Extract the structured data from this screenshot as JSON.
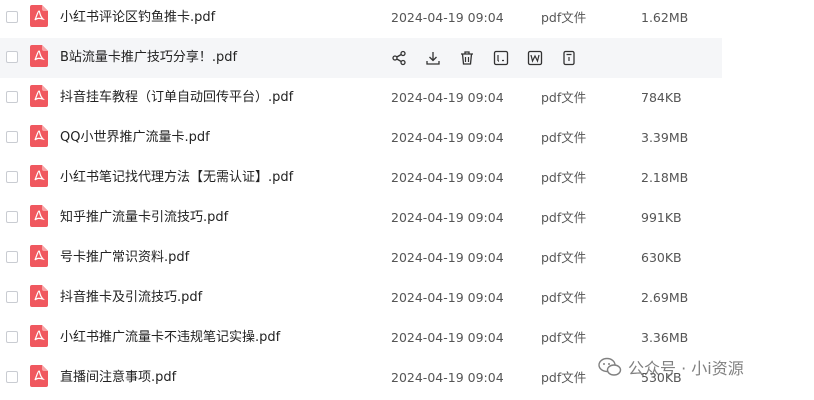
{
  "files": [
    {
      "name": "小红书评论区钓鱼推卡.pdf",
      "date": "2024-04-19 09:04",
      "type": "pdf文件",
      "size": "1.62MB"
    },
    {
      "name": "B站流量卡推广技巧分享！.pdf",
      "date": "",
      "type": "",
      "size": ""
    },
    {
      "name": "抖音挂车教程（订单自动回传平台）.pdf",
      "date": "2024-04-19 09:04",
      "type": "pdf文件",
      "size": "784KB"
    },
    {
      "name": "QQ小世界推广流量卡.pdf",
      "date": "2024-04-19 09:04",
      "type": "pdf文件",
      "size": "3.39MB"
    },
    {
      "name": "小红书笔记找代理方法【无需认证】.pdf",
      "date": "2024-04-19 09:04",
      "type": "pdf文件",
      "size": "2.18MB"
    },
    {
      "name": "知乎推广流量卡引流技巧.pdf",
      "date": "2024-04-19 09:04",
      "type": "pdf文件",
      "size": "991KB"
    },
    {
      "name": "号卡推广常识资料.pdf",
      "date": "2024-04-19 09:04",
      "type": "pdf文件",
      "size": "630KB"
    },
    {
      "name": "抖音推卡及引流技巧.pdf",
      "date": "2024-04-19 09:04",
      "type": "pdf文件",
      "size": "2.69MB"
    },
    {
      "name": "小红书推广流量卡不违规笔记实操.pdf",
      "date": "2024-04-19 09:04",
      "type": "pdf文件",
      "size": "3.36MB"
    },
    {
      "name": "直播间注意事项.pdf",
      "date": "2024-04-19 09:04",
      "type": "pdf文件",
      "size": "530KB"
    }
  ],
  "hover_actions": [
    "share-icon",
    "download-icon",
    "delete-icon",
    "rename-icon",
    "word-convert-icon",
    "print-icon"
  ],
  "watermark": {
    "text": "公众号 · 小i资源"
  },
  "colors": {
    "pdf_icon": "#f0585f",
    "hover_row": "#f5f6f8",
    "text": "#222222",
    "muted": "#555555"
  }
}
